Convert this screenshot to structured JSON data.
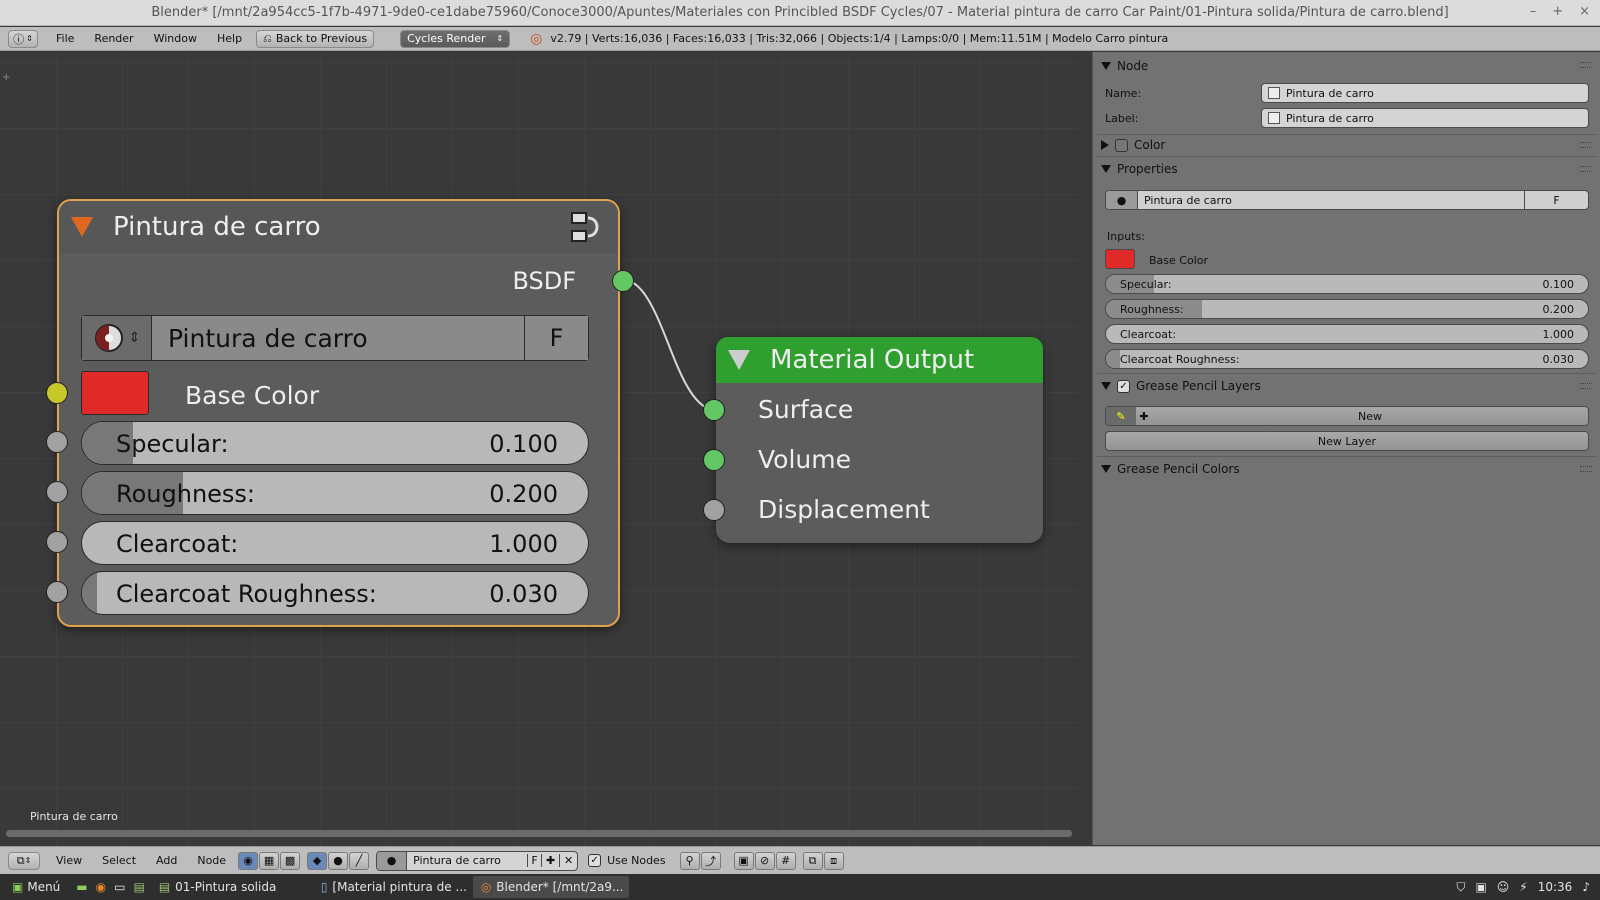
{
  "window": {
    "title": "Blender* [/mnt/2a954cc5-1f7b-4971-9de0-ce1dabe75960/Conoce3000/Apuntes/Materiales con Princibled BSDF Cycles/07 - Material pintura de carro Car Paint/01-Pintura solida/Pintura de carro.blend]",
    "controls": [
      "–",
      "+",
      "×"
    ]
  },
  "infobar": {
    "menus": [
      "File",
      "Render",
      "Window",
      "Help"
    ],
    "back_button": "Back to Previous",
    "engine": "Cycles Render",
    "stats": "v2.79 | Verts:16,036 | Faces:16,033 | Tris:32,066 | Objects:1/4 | Lamps:0/0 | Mem:11.51M | Modelo Carro pintura"
  },
  "editor": {
    "selected_label": "Pintura de carro",
    "group_node": {
      "title": "Pintura de carro",
      "output": "BSDF",
      "datablock": "Pintura de carro",
      "fake_user": "F",
      "base_color_label": "Base Color",
      "base_color": "#e02a2a",
      "inputs": [
        {
          "label": "Specular:",
          "value": "0.100",
          "fraction": 0.1
        },
        {
          "label": "Roughness:",
          "value": "0.200",
          "fraction": 0.2
        },
        {
          "label": "Clearcoat:",
          "value": "1.000",
          "fraction": 0.0
        },
        {
          "label": "Clearcoat Roughness:",
          "value": "0.030",
          "fraction": 0.03
        }
      ]
    },
    "output_node": {
      "title": "Material Output",
      "sockets": [
        "Surface",
        "Volume",
        "Displacement"
      ]
    }
  },
  "properties": {
    "node_section": "Node",
    "name_label": "Name:",
    "name_value": "Pintura de carro",
    "label_label": "Label:",
    "label_value": "Pintura de carro",
    "color_section": "Color",
    "properties_section": "Properties",
    "datablock": "Pintura de carro",
    "fake_user": "F",
    "inputs_label": "Inputs:",
    "base_color_label": "Base Color",
    "sliders": [
      {
        "label": "Specular:",
        "value": "0.100",
        "fraction": 0.1
      },
      {
        "label": "Roughness:",
        "value": "0.200",
        "fraction": 0.2
      },
      {
        "label": "Clearcoat:",
        "value": "1.000",
        "fraction": 0.0
      },
      {
        "label": "Clearcoat Roughness:",
        "value": "0.030",
        "fraction": 0.03
      }
    ],
    "grease_layers_section": "Grease Pencil Layers",
    "new_button": "New",
    "new_layer_button": "New Layer",
    "grease_colors_section": "Grease Pencil Colors"
  },
  "nodebar": {
    "menus": [
      "View",
      "Select",
      "Add",
      "Node"
    ],
    "material": "Pintura de carro",
    "fake_user": "F",
    "use_nodes": "Use Nodes"
  },
  "taskbar": {
    "menu": "Menú",
    "tasks": [
      "01-Pintura solida",
      "[Material pintura de ...",
      "Blender* [/mnt/2a9..."
    ],
    "clock": "10:36"
  },
  "colors": {
    "accent_orange": "#e0a24a",
    "output_header_green": "#2fa02f",
    "socket_green": "#63c763",
    "socket_yellow": "#c7c729",
    "base_color": "#e02a2a"
  }
}
